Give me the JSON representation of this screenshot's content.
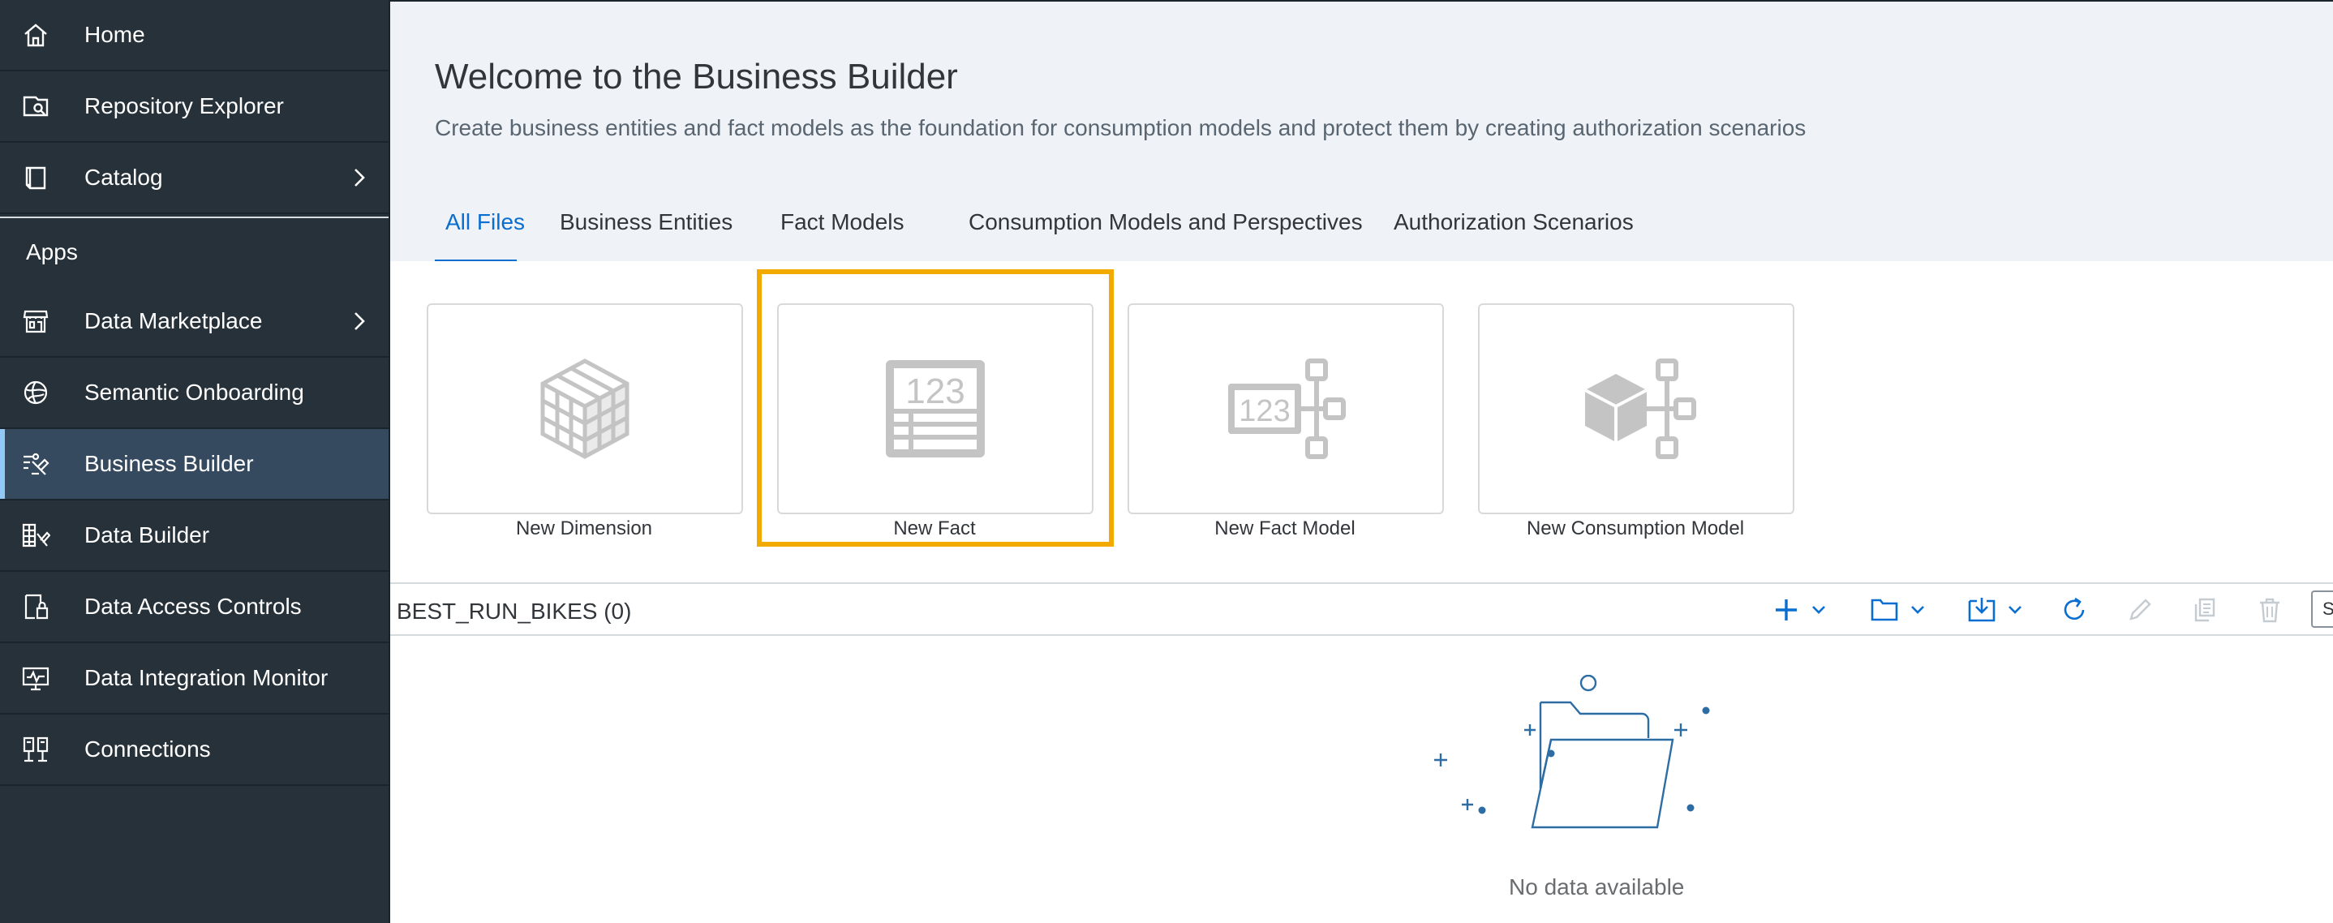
{
  "sidebar": {
    "items": [
      {
        "label": "Home",
        "icon": "home-icon"
      },
      {
        "label": "Repository Explorer",
        "icon": "repository-search-icon"
      },
      {
        "label": "Catalog",
        "icon": "catalog-book-icon",
        "has_submenu": true
      },
      {
        "label": "Data Marketplace",
        "icon": "storefront-icon",
        "has_submenu": true
      },
      {
        "label": "Semantic Onboarding",
        "icon": "globe-onboarding-icon"
      },
      {
        "label": "Business Builder",
        "icon": "business-builder-icon",
        "active": true
      },
      {
        "label": "Data Builder",
        "icon": "data-builder-icon"
      },
      {
        "label": "Data Access Controls",
        "icon": "data-access-lock-icon"
      },
      {
        "label": "Data Integration Monitor",
        "icon": "monitor-icon"
      },
      {
        "label": "Connections",
        "icon": "connections-icon"
      }
    ],
    "group_label": "Apps"
  },
  "header": {
    "title": "Welcome to the Business Builder",
    "subtitle": "Create business entities and fact models as the foundation for consumption models and protect them by creating authorization scenarios"
  },
  "tabs": [
    {
      "label": "All Files",
      "active": true
    },
    {
      "label": "Business Entities"
    },
    {
      "label": "Fact Models"
    },
    {
      "label": "Consumption Models and Perspectives"
    },
    {
      "label": "Authorization Scenarios"
    }
  ],
  "tiles": [
    {
      "label": "New Dimension",
      "icon": "dimension-cube-icon"
    },
    {
      "label": "New Fact",
      "icon": "fact-table-icon",
      "highlighted": true,
      "icon_text": "123"
    },
    {
      "label": "New Fact Model",
      "icon": "fact-model-icon",
      "icon_text": "123"
    },
    {
      "label": "New Consumption Model",
      "icon": "consumption-model-icon"
    }
  ],
  "repository": {
    "title": "BEST_RUN_BIKES (0)",
    "search_stub": "S"
  },
  "empty_state": {
    "message": "No data available",
    "illustration": "empty-folder-illustration"
  },
  "colors": {
    "sidebar_bg": "#26313a",
    "sidebar_active_bg": "#354a5f",
    "header_bg": "#eff3f7",
    "accent": "#0a6ed1",
    "highlight": "#f2a900",
    "tile_icon": "#c4c4c4",
    "illustration_blue": "#2d6da3"
  }
}
